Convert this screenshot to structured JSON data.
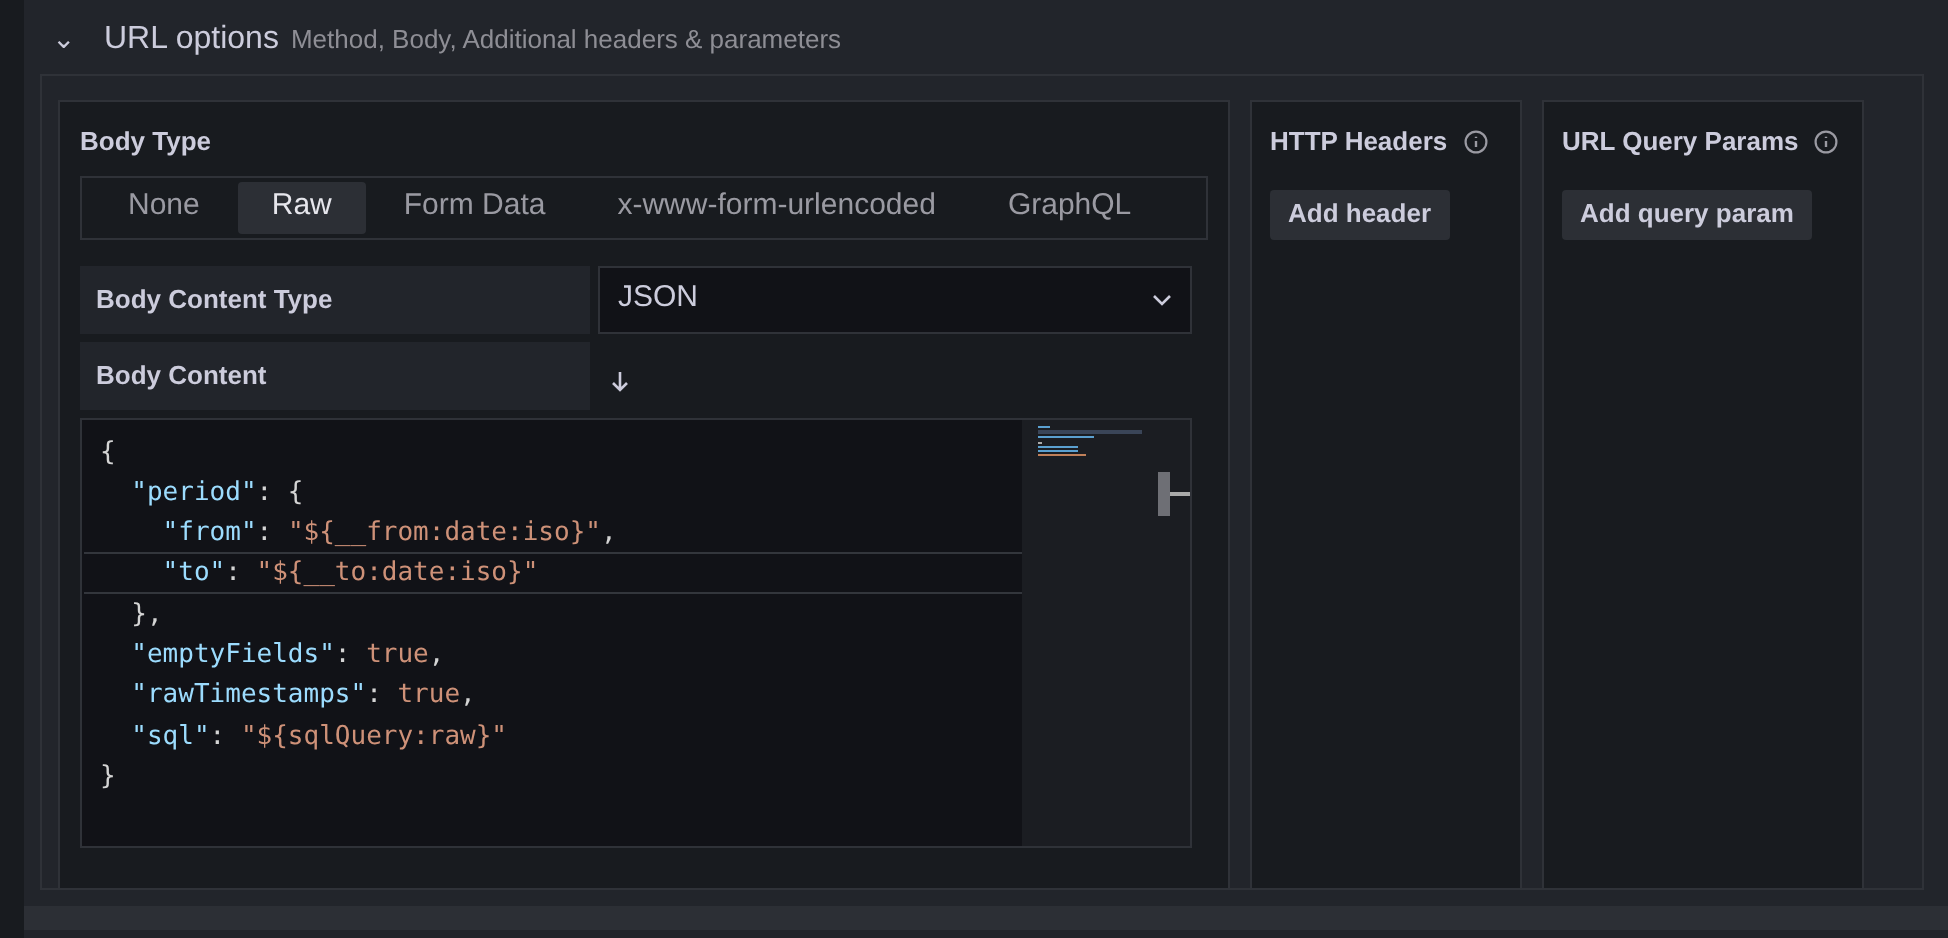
{
  "section": {
    "chevron": "⌄",
    "title": "URL options",
    "subtitle": "Method, Body, Additional headers & parameters",
    "expanded": true
  },
  "body": {
    "label": "Body Type",
    "tabs": [
      {
        "label": "None",
        "selected": false
      },
      {
        "label": "Raw",
        "selected": true
      },
      {
        "label": "Form Data",
        "selected": false
      },
      {
        "label": "x-www-form-urlencoded",
        "selected": false
      },
      {
        "label": "GraphQL",
        "selected": false
      }
    ],
    "content_type": {
      "label": "Body Content Type",
      "value": "JSON"
    },
    "content": {
      "label": "Body Content",
      "lines": [
        {
          "current": false,
          "tokens": [
            {
              "kind": "punct",
              "text": "{"
            }
          ]
        },
        {
          "current": false,
          "tokens": [
            {
              "kind": "key",
              "text": "  \"period\""
            },
            {
              "kind": "punct",
              "text": ": {"
            }
          ]
        },
        {
          "current": false,
          "tokens": [
            {
              "kind": "key",
              "text": "    \"from\""
            },
            {
              "kind": "punct",
              "text": ": "
            },
            {
              "kind": "string",
              "text": "\"${__from:date:iso}\""
            },
            {
              "kind": "punct",
              "text": ","
            }
          ]
        },
        {
          "current": true,
          "tokens": [
            {
              "kind": "key",
              "text": "    \"to\""
            },
            {
              "kind": "punct",
              "text": ": "
            },
            {
              "kind": "string",
              "text": "\"${__to:date:iso}\""
            }
          ]
        },
        {
          "current": false,
          "tokens": [
            {
              "kind": "punct",
              "text": "  },"
            }
          ]
        },
        {
          "current": false,
          "tokens": [
            {
              "kind": "key",
              "text": "  \"emptyFields\""
            },
            {
              "kind": "punct",
              "text": ": "
            },
            {
              "kind": "literal",
              "text": "true"
            },
            {
              "kind": "punct",
              "text": ","
            }
          ]
        },
        {
          "current": false,
          "tokens": [
            {
              "kind": "key",
              "text": "  \"rawTimestamps\""
            },
            {
              "kind": "punct",
              "text": ": "
            },
            {
              "kind": "literal",
              "text": "true"
            },
            {
              "kind": "punct",
              "text": ","
            }
          ]
        },
        {
          "current": false,
          "tokens": [
            {
              "kind": "key",
              "text": "  \"sql\""
            },
            {
              "kind": "punct",
              "text": ": "
            },
            {
              "kind": "string",
              "text": "\"${sqlQuery:raw}\""
            }
          ]
        },
        {
          "current": false,
          "tokens": [
            {
              "kind": "punct",
              "text": "}"
            }
          ]
        }
      ]
    }
  },
  "headers": {
    "title": "HTTP Headers",
    "button": "Add header"
  },
  "query_params": {
    "title": "URL Query Params",
    "button": "Add query param"
  }
}
